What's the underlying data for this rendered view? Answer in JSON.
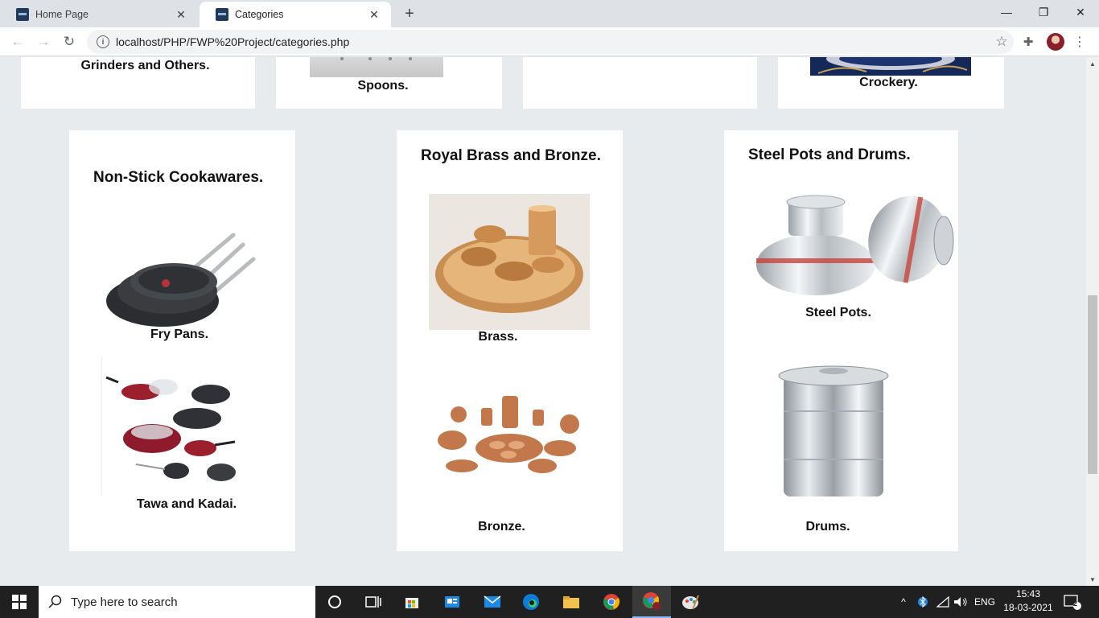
{
  "browser": {
    "tabs": [
      {
        "title": "Home Page"
      },
      {
        "title": "Categories"
      }
    ],
    "url": "localhost/PHP/FWP%20Project/categories.php",
    "close_glyph": "✕",
    "new_tab_glyph": "+",
    "window_controls": {
      "minimize": "—",
      "maximize": "❐",
      "close": "✕"
    },
    "nav": {
      "back": "←",
      "forward": "→",
      "reload": "↻"
    },
    "info_glyph": "i",
    "star_glyph": "☆",
    "extensions_glyph": "✚",
    "menu_glyph": "⋮"
  },
  "top_row": [
    {
      "label": "Grinders and Others."
    },
    {
      "label": "Spoons."
    },
    {
      "label": ""
    },
    {
      "label": "Crockery."
    }
  ],
  "cards": [
    {
      "title": "Non-Stick Cookawares.",
      "items": [
        {
          "label": "Fry Pans.",
          "icon": "fry-pans-image"
        },
        {
          "label": "Tawa and Kadai.",
          "icon": "tawa-kadai-image"
        }
      ]
    },
    {
      "title": "Royal Brass and Bronze.",
      "items": [
        {
          "label": "Brass.",
          "icon": "brass-thali-image"
        },
        {
          "label": "Bronze.",
          "icon": "bronze-set-image"
        }
      ]
    },
    {
      "title": "Steel Pots and Drums.",
      "items": [
        {
          "label": "Steel Pots.",
          "icon": "steel-pots-image"
        },
        {
          "label": "Drums.",
          "icon": "steel-drum-image"
        }
      ]
    }
  ],
  "taskbar": {
    "search_placeholder": "Type here to search",
    "language": "ENG",
    "time": "15:43",
    "date": "18-03-2021",
    "notifications_count": "2"
  },
  "colors": {
    "accent": "#1a73e8",
    "taskbar": "#202020",
    "page_bg": "#e8ebee"
  }
}
